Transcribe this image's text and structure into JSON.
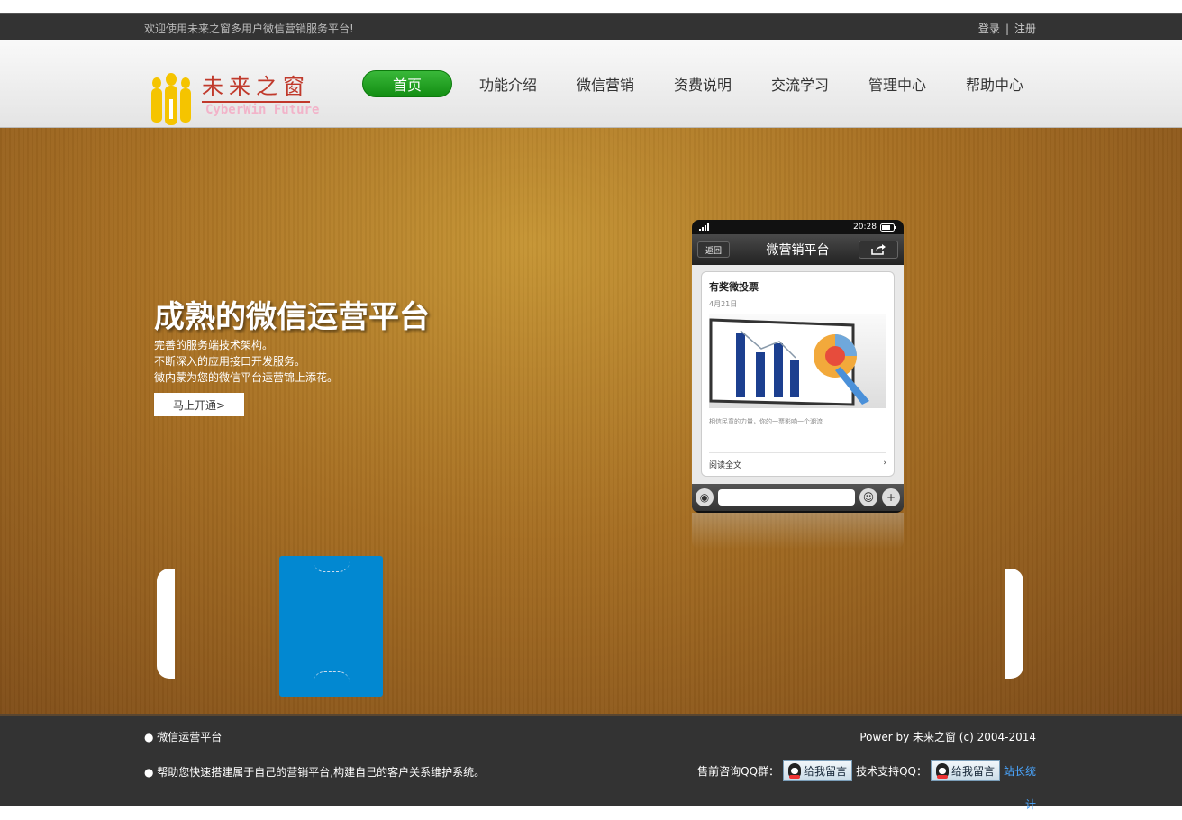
{
  "topbar": {
    "welcome": "欢迎使用未来之窗多用户微信营销服务平台!",
    "login": "登录",
    "separator": "|",
    "register": "注册"
  },
  "logo": {
    "cn": "未来之窗",
    "en": "CyberWin Future",
    "accent": "#c0392b"
  },
  "nav": {
    "items": [
      "首页",
      "功能介绍",
      "微信营销",
      "资费说明",
      "交流学习",
      "管理中心",
      "帮助中心"
    ],
    "active_color": "#1aa01a"
  },
  "banner": {
    "headline": "成熟的微信运营平台",
    "lines": [
      "完善的服务端技术架构。",
      "不断深入的应用接口开发服务。",
      "微内蒙为您的微信平台运营锦上添花。"
    ],
    "cta": "马上开通>"
  },
  "phone": {
    "time": "20:28",
    "back": "返回",
    "title": "微营销平台",
    "card_title": "有奖微投票",
    "card_date": "4月21日",
    "card_desc": "相信民意的力量，你的一票影响一个潮流",
    "read_more": "阅读全文"
  },
  "footer": {
    "left1": "● 微信运营平台",
    "left2": "● 帮助您快速搭建属于自己的营销平台,构建自己的客户关系维护系统。",
    "right1": "Power by 未来之窗 (c) 2004-2014",
    "presale": "售前咨询QQ群：",
    "qq_button": "给我留言",
    "tech": "技术支持QQ：",
    "stat_a": "站长统",
    "stat_b": "计"
  }
}
